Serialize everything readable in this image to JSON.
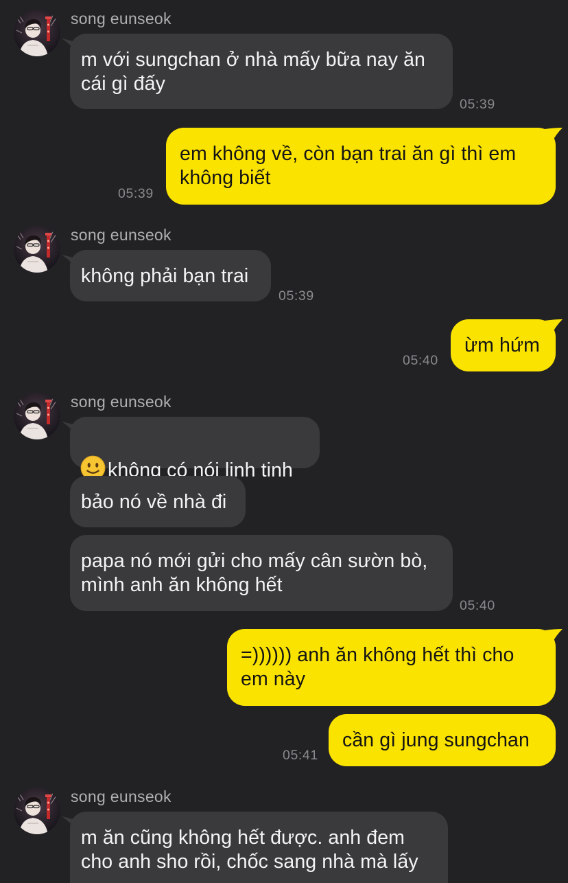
{
  "contact": {
    "name": "song eunseok"
  },
  "messages": [
    {
      "from": "them",
      "sender_name": "song eunseok",
      "text": "m với sungchan ở nhà mấy bữa nay ăn\ncái gì đấy",
      "time": "05:39"
    },
    {
      "from": "me",
      "text": "em không về, còn bạn trai ăn gì thì em\nkhông biết",
      "time": "05:39"
    },
    {
      "from": "them",
      "sender_name": "song eunseok",
      "text": "không phải bạn trai",
      "time": "05:39"
    },
    {
      "from": "me",
      "text": "ừm hứm",
      "time": "05:40"
    },
    {
      "from": "them",
      "sender_name": "song eunseok",
      "emoji": "slightly-smiling-face",
      "text": "không có nói linh tinh"
    },
    {
      "from": "them",
      "text": "bảo nó về nhà đi"
    },
    {
      "from": "them",
      "text": "papa nó mới gửi cho mấy cân sườn bò,\nmình anh ăn không hết",
      "time": "05:40"
    },
    {
      "from": "me",
      "text": "=)))))) anh ăn không hết thì cho\nem này"
    },
    {
      "from": "me",
      "text": "cần gì jung sungchan",
      "time": "05:41"
    },
    {
      "from": "them",
      "sender_name": "song eunseok",
      "text": "m ăn cũng không hết được. anh đem\ncho anh sho rồi, chốc sang nhà mà lấy"
    }
  ],
  "colors": {
    "background": "#222225",
    "incoming_bubble": "#3a3a3d",
    "outgoing_bubble": "#fbe300",
    "timestamp": "#8a8a8e"
  },
  "icons": {
    "avatar": "contact-avatar-photo",
    "emoji": "slightly-smiling-face"
  }
}
